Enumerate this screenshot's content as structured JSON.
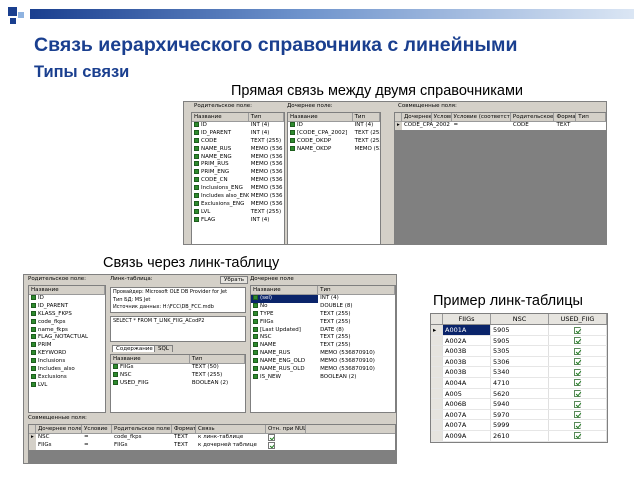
{
  "slide": {
    "title": "Связь иерархического справочника с линейными",
    "subtitle": "Типы связи",
    "caption_direct": "Прямая связь между двумя справочниками",
    "caption_link": "Связь через линк-таблицу",
    "caption_example": "Пример линк-таблицы",
    "bullet_colors": [
      "#1a3f8f",
      "#8fb3e0",
      "#c9d9ee"
    ]
  },
  "direct": {
    "parent_label": "Родительское поле:",
    "child_label": "Дочернее поле:",
    "linked_label": "Совмещенные поля:",
    "col_name": "Название",
    "col_type": "Тип",
    "parent_fields": [
      {
        "name": "ID",
        "type": "INT (4)"
      },
      {
        "name": "ID_PARENT",
        "type": "INT (4)"
      },
      {
        "name": "CODE",
        "type": "TEXT (255)"
      },
      {
        "name": "NAME_RUS",
        "type": "MEMO (536"
      },
      {
        "name": "NAME_ENG",
        "type": "MEMO (536"
      },
      {
        "name": "PRIM_RUS",
        "type": "MEMO (536"
      },
      {
        "name": "PRIM_ENG",
        "type": "MEMO (536"
      },
      {
        "name": "CODE_CN",
        "type": "MEMO (536"
      },
      {
        "name": "Inclusions_ENG",
        "type": "MEMO (536"
      },
      {
        "name": "Includes also_ENG",
        "type": "MEMO (536"
      },
      {
        "name": "Exclusions_ENG",
        "type": "MEMO (536"
      },
      {
        "name": "LVL",
        "type": "TEXT (255)"
      },
      {
        "name": "FLAG",
        "type": "INT (4)"
      }
    ],
    "child_fields": [
      {
        "name": "ID",
        "type": "INT (4)"
      },
      {
        "name": "[CODE_CPA_2002]",
        "type": "TEXT (255)"
      },
      {
        "name": "CODE_OKDP",
        "type": "TEXT (255)"
      },
      {
        "name": "NAME_OKDP",
        "type": "MEMO (536"
      }
    ],
    "linked_headers": [
      "Дочернее поле",
      "Условие",
      "Условие (соответствие)",
      "Родительское поле",
      "Формат",
      "Тип"
    ],
    "linked_rows": [
      [
        "CODE_CPA_2002",
        "=",
        "",
        "CODE",
        "TEXT"
      ]
    ]
  },
  "link": {
    "parent_label": "Родительское поле:",
    "linktable_label": "Линк-таблица:",
    "remove_button": "Убрать",
    "child_label": "Дочернее поле",
    "linked_label": "Совмещенные поля:",
    "parent_fields": [
      "ID",
      "ID_PARENT",
      "KLASS_FKPS",
      "code_fkps",
      "name_fkps",
      "FLAG_NOTACTUAL",
      "PRIM",
      "KEYWORD",
      "Inclusions",
      "Includes_also",
      "Exclusions",
      "LVL"
    ],
    "provider_lines": [
      "Провайдер: Microsoft OLE DB Provider for Jet",
      "Тип БД: MS Jet",
      "Источник данных: H:\\FCC\\DB_FCC.mdb"
    ],
    "sql_text": "SELECT * FROM T_LINK_FIIG_ACodP2",
    "tab_content": "Содержание",
    "tab_sql": "SQL",
    "col_name": "Название",
    "col_type": "Тип",
    "link_fields": [
      {
        "name": "FIIGs",
        "type": "TEXT (50)"
      },
      {
        "name": "NSC",
        "type": "TEXT (255)"
      },
      {
        "name": "USED_FIIG",
        "type": "BOOLEAN (2)"
      }
    ],
    "child_fields": [
      {
        "name": "(sel)",
        "type": "INT (4)"
      },
      {
        "name": "No",
        "type": "DOUBLE (8)"
      },
      {
        "name": "TYPE",
        "type": "TEXT (255)"
      },
      {
        "name": "FIIGs",
        "type": "TEXT (255)"
      },
      {
        "name": "[Last Updated]",
        "type": "DATE (8)"
      },
      {
        "name": "NSC",
        "type": "TEXT (255)"
      },
      {
        "name": "NAME",
        "type": "TEXT (255)"
      },
      {
        "name": "NAME_RUS",
        "type": "MEMO (536870910)"
      },
      {
        "name": "NAME_ENG_OLD",
        "type": "MEMO (536870910)"
      },
      {
        "name": "NAME_RUS_OLD",
        "type": "MEMO (536870910)"
      },
      {
        "name": "IS_NEW",
        "type": "BOOLEAN (2)"
      }
    ],
    "linked_headers": [
      "Дочернее поле",
      "Условие",
      "Родительское поле",
      "Формат",
      "Связь",
      "Отн. при NULL"
    ],
    "linked_rows": [
      [
        "NSC",
        "=",
        "code_fkps",
        "TEXT",
        "к линк-таблице"
      ],
      [
        "FIIGs",
        "=",
        "FIIGs",
        "TEXT",
        "к дочерней таблице"
      ]
    ]
  },
  "example": {
    "headers": [
      "FIIGs",
      "NSC",
      "USED_FIIG"
    ],
    "rows": [
      {
        "fiig": "A001A",
        "nsc": "5905",
        "used": true
      },
      {
        "fiig": "A002A",
        "nsc": "5905",
        "used": true
      },
      {
        "fiig": "A003B",
        "nsc": "5305",
        "used": true
      },
      {
        "fiig": "A003B",
        "nsc": "5306",
        "used": true
      },
      {
        "fiig": "A003B",
        "nsc": "5340",
        "used": true
      },
      {
        "fiig": "A004A",
        "nsc": "4710",
        "used": true
      },
      {
        "fiig": "A005",
        "nsc": "5620",
        "used": true
      },
      {
        "fiig": "A006B",
        "nsc": "5940",
        "used": true
      },
      {
        "fiig": "A007A",
        "nsc": "5970",
        "used": true
      },
      {
        "fiig": "A007A",
        "nsc": "5999",
        "used": true
      },
      {
        "fiig": "A009A",
        "nsc": "2610",
        "used": true
      }
    ]
  }
}
